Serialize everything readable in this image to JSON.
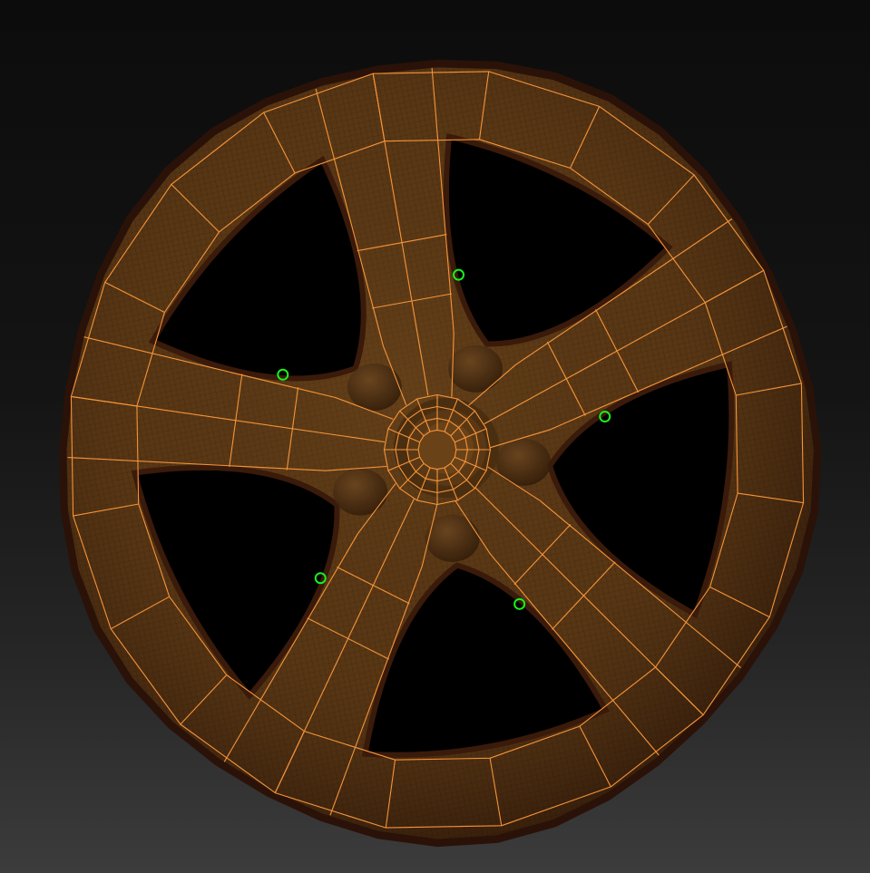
{
  "viewport": {
    "background_top": "#0c0c0c",
    "background_bottom": "#3c3c3c"
  },
  "model": {
    "name": "wheel-rim",
    "surface_color": "#5a3815",
    "shadow_color": "#2a1208",
    "wire_color": "#ff9a3c",
    "fine_grid_color": "#1a0f04",
    "spoke_count": 5
  },
  "markers": {
    "color": "#17f21b",
    "count": 5,
    "icon": "circle-outline"
  }
}
